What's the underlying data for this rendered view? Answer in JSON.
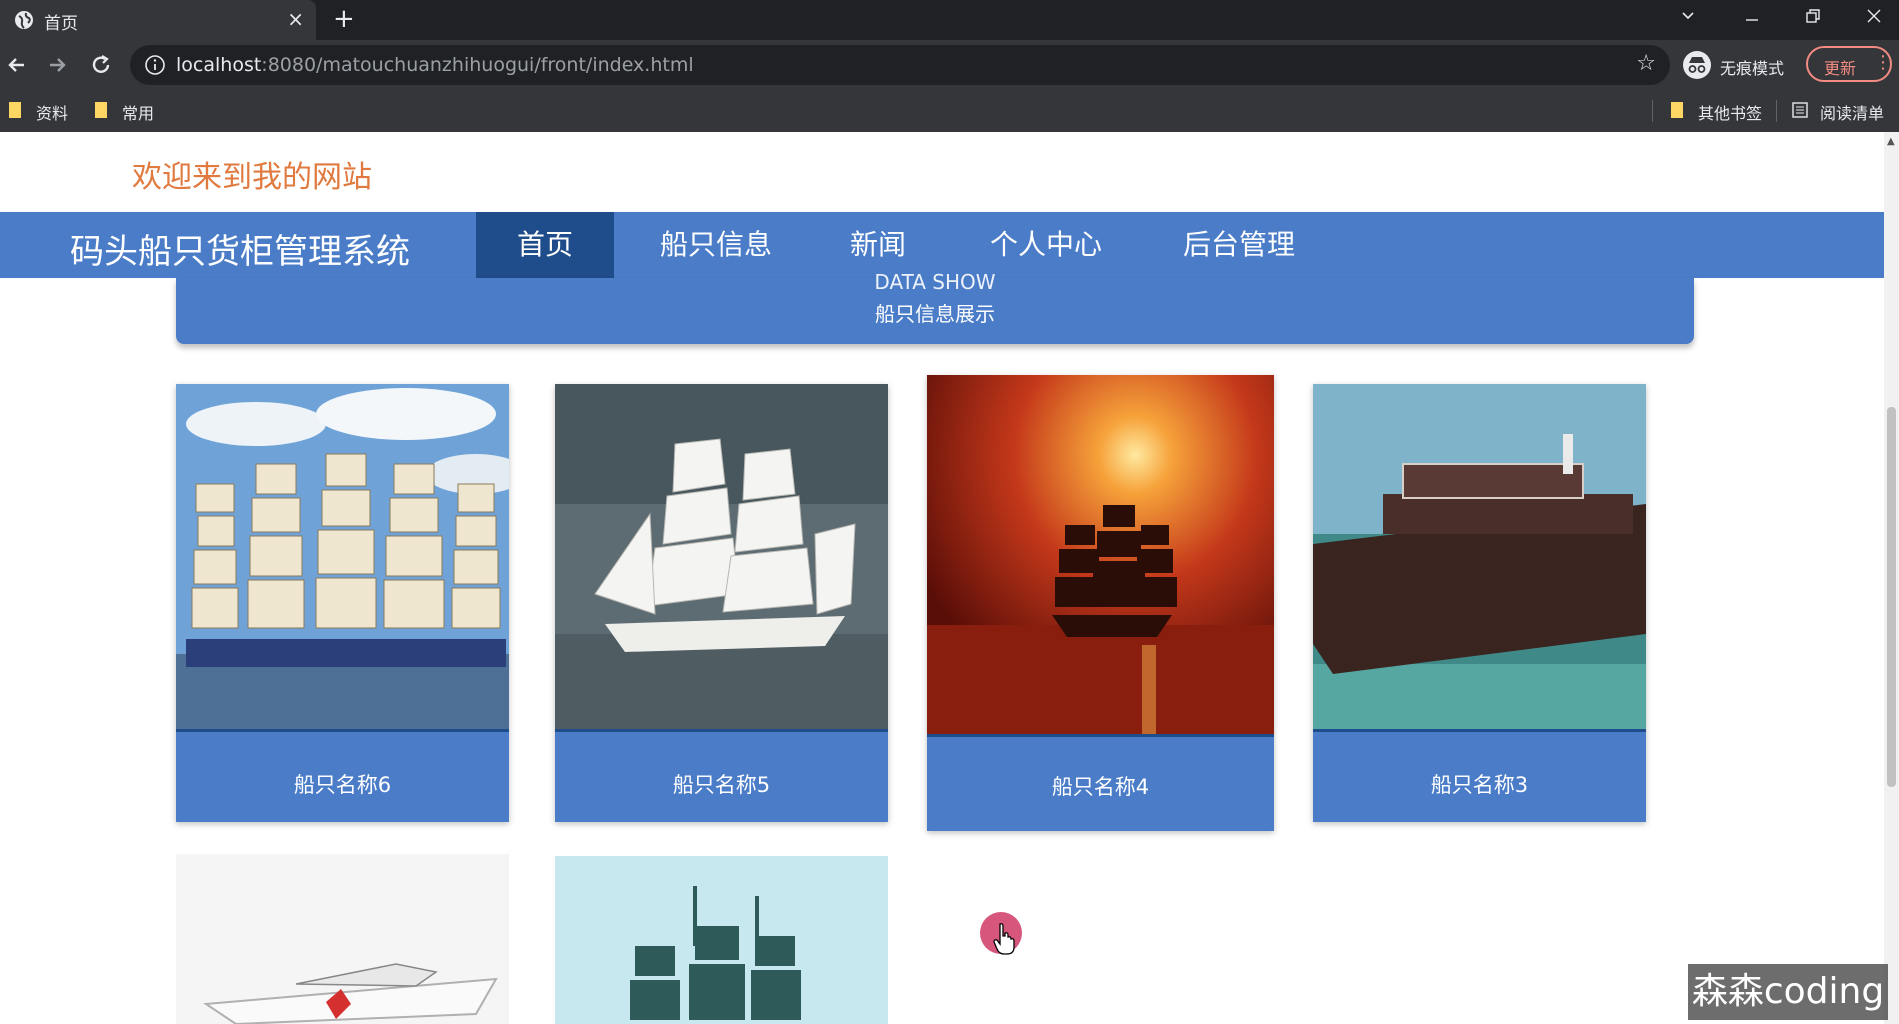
{
  "browser": {
    "tab_title": "首页",
    "tab_close": "×",
    "new_tab": "+",
    "url_host": "localhost",
    "url_rest": ":8080/matouchuanzhihuogui/front/index.html",
    "incognito_label": "无痕模式",
    "update_label": "更新",
    "bookmarks": [
      {
        "label": "资料"
      },
      {
        "label": "常用"
      },
      {
        "label": "其他书签"
      },
      {
        "label": "阅读清单"
      }
    ]
  },
  "page": {
    "welcome": "欢迎来到我的网站",
    "brand": "码头船只货柜管理系统",
    "nav": [
      {
        "label": "首页",
        "active": true
      },
      {
        "label": "船只信息"
      },
      {
        "label": "新闻"
      },
      {
        "label": "个人中心"
      },
      {
        "label": "后台管理"
      }
    ],
    "section_en": "DATA SHOW",
    "section_cn": "船只信息展示",
    "cards": [
      {
        "name": "船只名称6"
      },
      {
        "name": "船只名称5"
      },
      {
        "name": "船只名称4"
      },
      {
        "name": "船只名称3"
      }
    ],
    "watermark": "森森coding"
  },
  "colors": {
    "nav_bg": "#4a7cc8",
    "nav_active": "#1f4c8a",
    "welcome": "#e07a3f"
  }
}
